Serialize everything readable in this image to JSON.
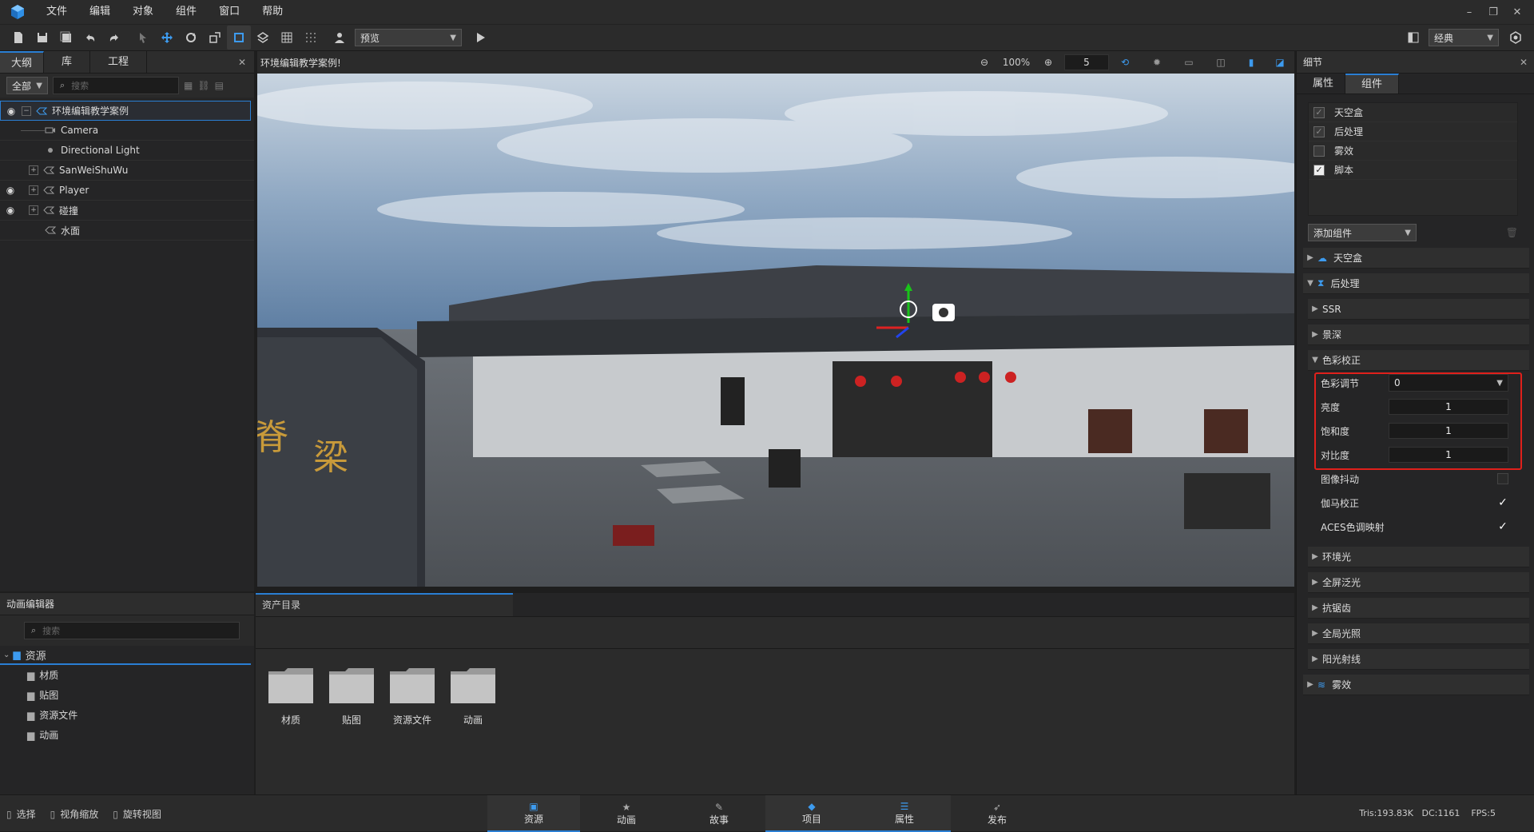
{
  "menu": [
    "文件",
    "编辑",
    "对象",
    "组件",
    "窗口",
    "帮助"
  ],
  "toolbar": {
    "preview_select": "预览",
    "layout_select": "经典"
  },
  "outline": {
    "tabs": [
      "大纲",
      "库",
      "工程"
    ],
    "filter": "全部",
    "search_placeholder": "搜索",
    "nodes": [
      {
        "label": "环境编辑教学案例"
      },
      {
        "label": "Camera"
      },
      {
        "label": "Directional Light"
      },
      {
        "label": "SanWeiShuWu"
      },
      {
        "label": "Player"
      },
      {
        "label": "碰撞"
      },
      {
        "label": "水面"
      }
    ]
  },
  "viewport": {
    "title": "环境编辑教学案例!",
    "zoom": "100%",
    "speed": "5"
  },
  "details": {
    "title": "细节",
    "tabs": [
      "属性",
      "组件"
    ],
    "components": [
      {
        "label": "天空盒",
        "checked": true
      },
      {
        "label": "后处理",
        "checked": true
      },
      {
        "label": "雾效",
        "checked": false
      },
      {
        "label": "脚本",
        "checked": true
      }
    ],
    "add_component": "添加组件",
    "sections": {
      "skybox": "天空盒",
      "postprocess": "后处理",
      "ssr": "SSR",
      "dof": "景深",
      "color_correction": "色彩校正",
      "ambient": "环境光",
      "bloom": "全屏泛光",
      "aa": "抗锯齿",
      "gi": "全局光照",
      "sunrays": "阳光射线",
      "fog": "雾效"
    },
    "color": {
      "adjust_label": "色彩调节",
      "adjust_value": "0",
      "brightness_label": "亮度",
      "brightness_value": "1",
      "saturation_label": "饱和度",
      "saturation_value": "1",
      "contrast_label": "对比度",
      "contrast_value": "1",
      "jitter_label": "图像抖动",
      "gamma_label": "伽马校正",
      "aces_label": "ACES色调映射"
    }
  },
  "anim_editor": {
    "title": "动画编辑器",
    "search_placeholder": "搜索",
    "root": "资源",
    "children": [
      "材质",
      "贴图",
      "资源文件",
      "动画"
    ]
  },
  "assets": {
    "tab": "资产目录",
    "folders": [
      "材质",
      "贴图",
      "资源文件",
      "动画"
    ]
  },
  "status": {
    "modes": [
      "选择",
      "视角缩放",
      "旋转视图"
    ],
    "bottom_tabs": [
      "资源",
      "动画",
      "故事",
      "项目",
      "属性",
      "发布"
    ],
    "stats": "Tris:193.83K   DC:1161    FPS:5"
  },
  "colors": {
    "accent": "#2a7fd4",
    "highlight_box": "#e0201b"
  }
}
